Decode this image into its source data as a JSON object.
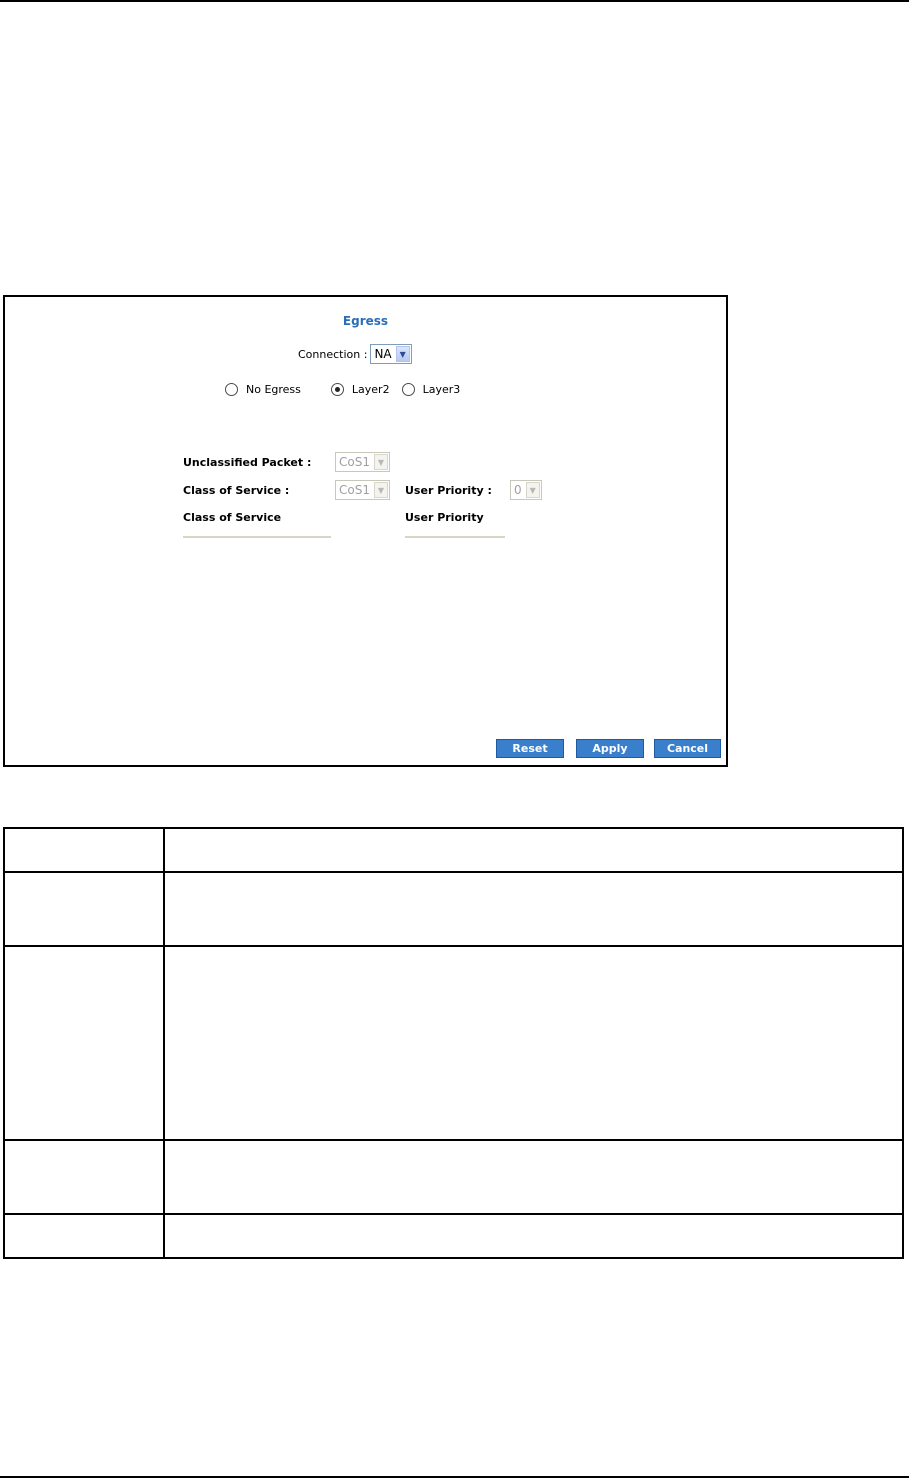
{
  "egress": {
    "title": "Egress",
    "connection_label": "Connection :",
    "connection_value": "NA",
    "radio_options": [
      {
        "label": "No Egress",
        "selected": false
      },
      {
        "label": "Layer2",
        "selected": true
      },
      {
        "label": "Layer3",
        "selected": false
      }
    ],
    "unclassified_packet_label": "Unclassified Packet :",
    "unclassified_packet_value": "CoS1",
    "class_of_service_label": "Class of Service :",
    "class_of_service_value": "CoS1",
    "user_priority_label": "User Priority :",
    "user_priority_value": "0",
    "col_class_of_service": "Class of Service",
    "col_user_priority": "User Priority"
  },
  "buttons": {
    "reset": "Reset",
    "apply": "Apply",
    "cancel": "Cancel"
  },
  "colors": {
    "title": "#2a6db8",
    "button": "#3a7fcb"
  }
}
